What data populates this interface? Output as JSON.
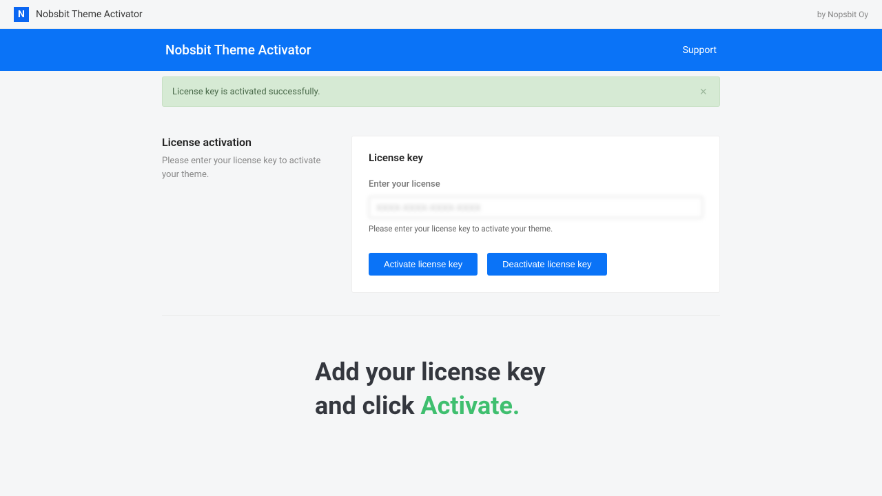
{
  "topbar": {
    "logo_letter": "N",
    "title": "Nobsbit Theme Activator",
    "vendor": "by Nopsbit Oy"
  },
  "header": {
    "title": "Nobsbit Theme Activator",
    "support_link": "Support"
  },
  "alert": {
    "message": "License key is activated successfully.",
    "close": "×"
  },
  "sidebar": {
    "heading": "License activation",
    "description": "Please enter your license key to activate your theme."
  },
  "card": {
    "title": "License key",
    "field_label": "Enter your license",
    "input_value": "XXXX-XXXX-XXXX-XXXX",
    "help_text": "Please enter your license key to activate your theme.",
    "activate_button": "Activate license key",
    "deactivate_button": "Deactivate license key"
  },
  "promo": {
    "line1": "Add your license key",
    "line2_prefix": "and click ",
    "line2_highlight": "Activate."
  }
}
